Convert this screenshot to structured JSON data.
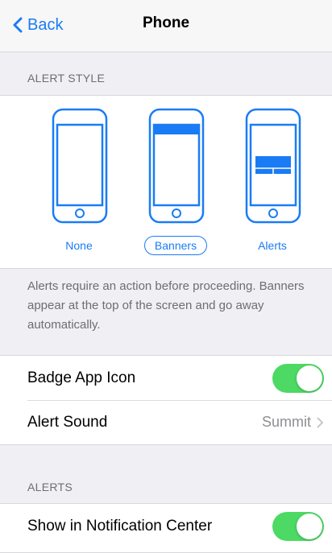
{
  "nav": {
    "back_label": "Back",
    "title": "Phone"
  },
  "alert_style": {
    "header": "ALERT STYLE",
    "options": [
      {
        "label": "None",
        "selected": false
      },
      {
        "label": "Banners",
        "selected": true
      },
      {
        "label": "Alerts",
        "selected": false
      }
    ],
    "footer": "Alerts require an action before proceeding. Banners appear at the top of the screen and go away automatically."
  },
  "settings": {
    "badge_app_icon": {
      "label": "Badge App Icon",
      "on": true
    },
    "alert_sound": {
      "label": "Alert Sound",
      "value": "Summit"
    }
  },
  "alerts_section": {
    "header": "ALERTS",
    "show_in_notification_center": {
      "label": "Show in Notification Center",
      "on": true
    }
  },
  "colors": {
    "accent": "#1a7cf5",
    "toggle_on": "#4cd964",
    "background": "#efeff4"
  },
  "icons": [
    "chevron-left-icon",
    "chevron-right-icon"
  ]
}
